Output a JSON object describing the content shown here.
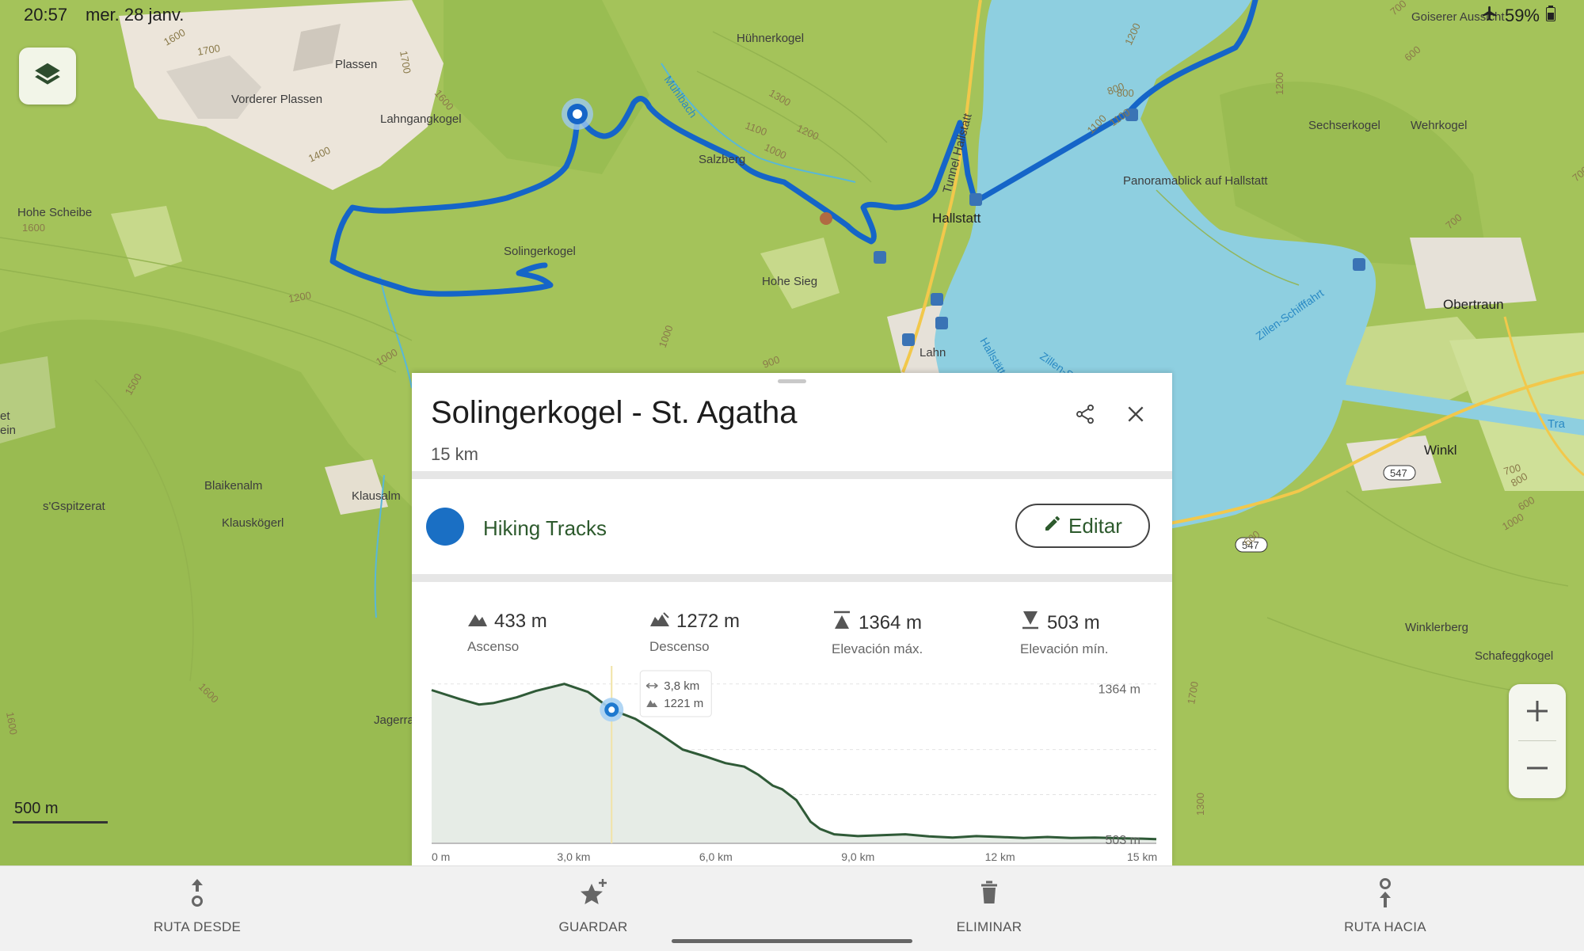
{
  "status_bar": {
    "time": "20:57",
    "date": "mer. 28 janv.",
    "battery": "59%"
  },
  "map": {
    "scale_label": "500 m",
    "labels": {
      "plassen": "Plassen",
      "vorderer_plassen": "Vorderer Plassen",
      "lahngangkogel": "Lahngangkogel",
      "hohe_scheibe": "Hohe Scheibe",
      "huehnerkogel": "Hühnerkogel",
      "muehlbach": "Mühlbach",
      "salzberg": "Salzberg",
      "solingerkogel": "Solingerkogel",
      "hohe_sieg": "Hohe Sieg",
      "hallstatt": "Hallstatt",
      "tunnel_hallstatt": "Tunnel Hallstatt",
      "lahn": "Lahn",
      "blaikenalm": "Blaikenalm",
      "klausalm": "Klausalm",
      "gspitzerat": "s'Gspitzerat",
      "klauskoegerl": "Klauskögerl",
      "jagerra": "Jagerra",
      "goiserer_aussicht": "Goiserer Aussicht",
      "sechserkogel": "Sechserkogel",
      "wehrkogel": "Wehrkogel",
      "panoramablick": "Panoramablick auf Hallstatt",
      "obertraun": "Obertraun",
      "zillen_schifffahrt": "Zillen-Schifffahrt",
      "zillen_s": "Zillen-S",
      "hallstaetter": "Hallstätter",
      "winkl": "Winkl",
      "winklerberg": "Winklerberg",
      "schafeggkogel": "Schafeggkogel",
      "road_547": "547",
      "tra": "Tra",
      "et": "et",
      "ein": "ein"
    },
    "contours": [
      "1600",
      "1700",
      "1700",
      "1600",
      "1400",
      "1600",
      "1200",
      "1300",
      "1100",
      "1200",
      "1000",
      "1200",
      "1000",
      "1500",
      "1000",
      "900",
      "1100",
      "700",
      "1100",
      "700",
      "800",
      "700",
      "600",
      "800",
      "600",
      "800",
      "600",
      "1000",
      "1700",
      "1300",
      "1600",
      "1600",
      "1200",
      "700"
    ]
  },
  "sheet": {
    "title": "Solingerkogel - St. Agatha",
    "distance": "15 km",
    "track_type": "Hiking Tracks",
    "track_color": "#1a6fc4",
    "edit_label": "Editar",
    "stats": [
      {
        "icon": "ascent-icon",
        "value": "433 m",
        "label": "Ascenso"
      },
      {
        "icon": "descent-icon",
        "value": "1272 m",
        "label": "Descenso"
      },
      {
        "icon": "max-elevation-icon",
        "value": "1364 m",
        "label": "Elevación máx."
      },
      {
        "icon": "min-elevation-icon",
        "value": "503 m",
        "label": "Elevación mín."
      }
    ]
  },
  "chart_data": {
    "type": "area",
    "x_unit": "km",
    "y_unit": "m",
    "xlim": [
      0,
      15.3
    ],
    "ylim": [
      480,
      1420
    ],
    "x_ticks": [
      "0 m",
      "3,0 km",
      "6,0 km",
      "9,0 km",
      "12 km",
      "15 km"
    ],
    "y_labels": {
      "max": "1364 m",
      "min": "503 m"
    },
    "points": [
      [
        0,
        1330
      ],
      [
        0.6,
        1280
      ],
      [
        1.0,
        1250
      ],
      [
        1.3,
        1258
      ],
      [
        1.8,
        1290
      ],
      [
        2.2,
        1325
      ],
      [
        2.8,
        1364
      ],
      [
        3.3,
        1320
      ],
      [
        3.8,
        1221
      ],
      [
        4.3,
        1170
      ],
      [
        4.8,
        1090
      ],
      [
        5.3,
        1000
      ],
      [
        5.8,
        960
      ],
      [
        6.2,
        925
      ],
      [
        6.6,
        905
      ],
      [
        6.9,
        860
      ],
      [
        7.2,
        800
      ],
      [
        7.4,
        780
      ],
      [
        7.7,
        720
      ],
      [
        8.0,
        600
      ],
      [
        8.2,
        560
      ],
      [
        8.5,
        530
      ],
      [
        9.0,
        520
      ],
      [
        9.5,
        525
      ],
      [
        10.0,
        530
      ],
      [
        10.5,
        518
      ],
      [
        11.0,
        512
      ],
      [
        11.5,
        520
      ],
      [
        12.0,
        515
      ],
      [
        12.5,
        510
      ],
      [
        13.0,
        515
      ],
      [
        13.5,
        510
      ],
      [
        14.0,
        512
      ],
      [
        14.5,
        508
      ],
      [
        15.0,
        506
      ],
      [
        15.3,
        503
      ]
    ],
    "marker": {
      "distance_km": 3.8,
      "elevation_m": 1221,
      "distance_label": "3,8 km",
      "elevation_label": "1221 m"
    }
  },
  "actions": [
    {
      "icon": "route-from-icon",
      "label": "RUTA DESDE"
    },
    {
      "icon": "save-star-icon",
      "label": "GUARDAR"
    },
    {
      "icon": "trash-icon",
      "label": "ELIMINAR"
    },
    {
      "icon": "route-to-icon",
      "label": "RUTA HACIA"
    }
  ]
}
